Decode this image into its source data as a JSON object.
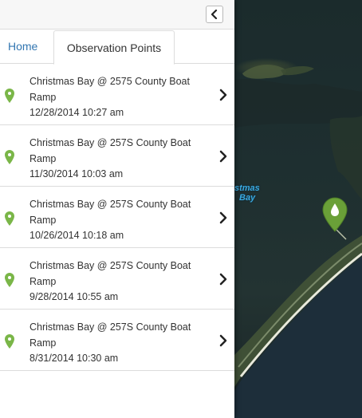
{
  "header": {
    "collapse_icon": "chevron-left-icon"
  },
  "tabs": [
    {
      "label": "Home",
      "active": false
    },
    {
      "label": "Observation Points",
      "active": true
    }
  ],
  "observations": [
    {
      "title": "Christmas Bay @ 2575 County Boat Ramp",
      "date": "12/28/2014 10:27 am"
    },
    {
      "title": "Christmas Bay @ 257S County Boat Ramp",
      "date": "11/30/2014 10:03 am"
    },
    {
      "title": "Christmas Bay @ 257S County Boat Ramp",
      "date": "10/26/2014 10:18 am"
    },
    {
      "title": "Christmas Bay @ 257S County Boat Ramp",
      "date": "9/28/2014 10:55 am"
    },
    {
      "title": "Christmas Bay @ 257S County Boat Ramp",
      "date": "8/31/2014 10:30 am"
    }
  ],
  "map": {
    "label_line1": "stmas",
    "label_line2": "Bay",
    "pin_icon": "water-drop-icon",
    "pin_color": "#6aa038"
  },
  "colors": {
    "link": "#3276b1",
    "leaf": "#7ab648",
    "label": "#3aa9e0"
  }
}
